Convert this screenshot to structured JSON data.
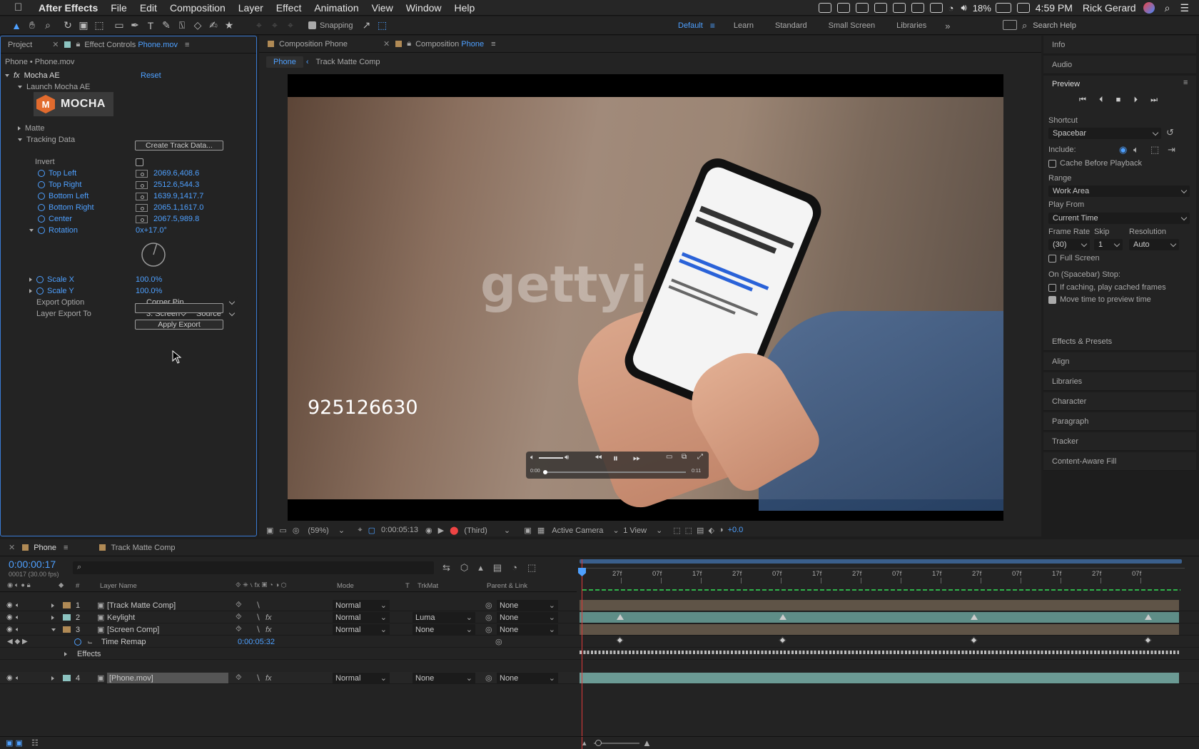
{
  "menubar": {
    "items": [
      "After Effects",
      "File",
      "Edit",
      "Composition",
      "Layer",
      "Effect",
      "Animation",
      "View",
      "Window",
      "Help"
    ],
    "battery": "18%",
    "time": "4:59 PM",
    "user": "Rick Gerard"
  },
  "toolbar": {
    "snapping": "Snapping",
    "workspaces": [
      "Default",
      "Learn",
      "Standard",
      "Small Screen",
      "Libraries"
    ],
    "search_placeholder": "Search Help"
  },
  "effect_panel": {
    "tab_project": "Project",
    "tab_effect_prefix": "Effect Controls",
    "tab_effect_layer": "Phone.mov",
    "breadcrumb": "Phone • Phone.mov",
    "effect_name": "Mocha AE",
    "reset": "Reset",
    "launch": "Launch Mocha AE",
    "logo_text": "MOCHA",
    "matte": "Matte",
    "tracking_data": "Tracking Data",
    "create_track_data": "Create Track Data...",
    "invert": "Invert",
    "params": [
      {
        "name": "Top Left",
        "value": "2069.6,408.6"
      },
      {
        "name": "Top Right",
        "value": "2512.6,544.3"
      },
      {
        "name": "Bottom Left",
        "value": "1639.9,1417.7"
      },
      {
        "name": "Bottom Right",
        "value": "2065.1,1617.0"
      },
      {
        "name": "Center",
        "value": "2067.5,989.8"
      }
    ],
    "rotation_label": "Rotation",
    "rotation_value": "0x+17.0°",
    "scale_x_label": "Scale X",
    "scale_x_value": "100.0%",
    "scale_y_label": "Scale Y",
    "scale_y_value": "100.0%",
    "export_option_label": "Export Option",
    "export_option_value": "Corner Pin",
    "layer_export_label": "Layer Export To",
    "layer_export_value": "3. Screen",
    "layer_export_source": "Source",
    "apply_export": "Apply Export"
  },
  "comp_panel": {
    "tab_label_prefix": "Composition",
    "tab_label_name": "Phone",
    "breadcrumb_active": "Phone",
    "breadcrumb_next": "Track Matte Comp",
    "overlay_number": "925126630",
    "watermark": "gettyi",
    "video_time_start": "0:00",
    "video_time_end": "0:11",
    "zoom": "(59%)",
    "timecode": "0:00:05:13",
    "resolution": "(Third)",
    "camera": "Active Camera",
    "views": "1 View",
    "exposure": "+0.0"
  },
  "right_panel": {
    "info": "Info",
    "audio": "Audio",
    "preview": "Preview",
    "shortcut_label": "Shortcut",
    "shortcut_value": "Spacebar",
    "include_label": "Include:",
    "cache_before": "Cache Before Playback",
    "range_label": "Range",
    "range_value": "Work Area",
    "play_from_label": "Play From",
    "play_from_value": "Current Time",
    "frame_rate_label": "Frame Rate",
    "skip_label": "Skip",
    "resolution_label": "Resolution",
    "frame_rate_value": "(30)",
    "skip_value": "1",
    "resolution_value": "Auto",
    "full_screen": "Full Screen",
    "on_stop": "On (Spacebar) Stop:",
    "if_caching": "If caching, play cached frames",
    "move_time": "Move time to preview time",
    "collapsed": [
      "Effects & Presets",
      "Align",
      "Libraries",
      "Character",
      "Paragraph",
      "Tracker",
      "Content-Aware Fill"
    ]
  },
  "timeline": {
    "tab_active": "Phone",
    "tab_other": "Track Matte Comp",
    "current_time": "0:00:00:17",
    "frame_info": "00017 (30.00 fps)",
    "col_layer_name": "Layer Name",
    "col_mode": "Mode",
    "col_t": "T",
    "col_trkmat": "TrkMat",
    "col_parent": "Parent & Link",
    "col_num": "#",
    "ruler": [
      "27f",
      "07f",
      "17f",
      "27f",
      "07f",
      "17f",
      "27f",
      "07f",
      "17f",
      "27f",
      "07f",
      "17f",
      "27f",
      "07f"
    ],
    "layers": [
      {
        "num": "1",
        "name": "[Track Matte Comp]",
        "mode": "Normal",
        "trkmat": "",
        "parent": "None",
        "color": "#b08a55"
      },
      {
        "num": "2",
        "name": "Keylight",
        "mode": "Normal",
        "trkmat": "Luma",
        "parent": "None",
        "color": "#8cc3c0"
      },
      {
        "num": "3",
        "name": "[Screen Comp]",
        "mode": "Normal",
        "trkmat": "None",
        "parent": "None",
        "color": "#b08a55"
      },
      {
        "num": "4",
        "name": "[Phone.mov]",
        "mode": "Normal",
        "trkmat": "None",
        "parent": "None",
        "color": "#8cc3c0"
      }
    ],
    "time_remap_label": "Time Remap",
    "time_remap_value": "0:00:05:32",
    "effects_label": "Effects"
  },
  "colors": {
    "accent": "#4ea0ff",
    "teal_bar": "#5e8d87",
    "brown_bar": "#5f5447"
  }
}
